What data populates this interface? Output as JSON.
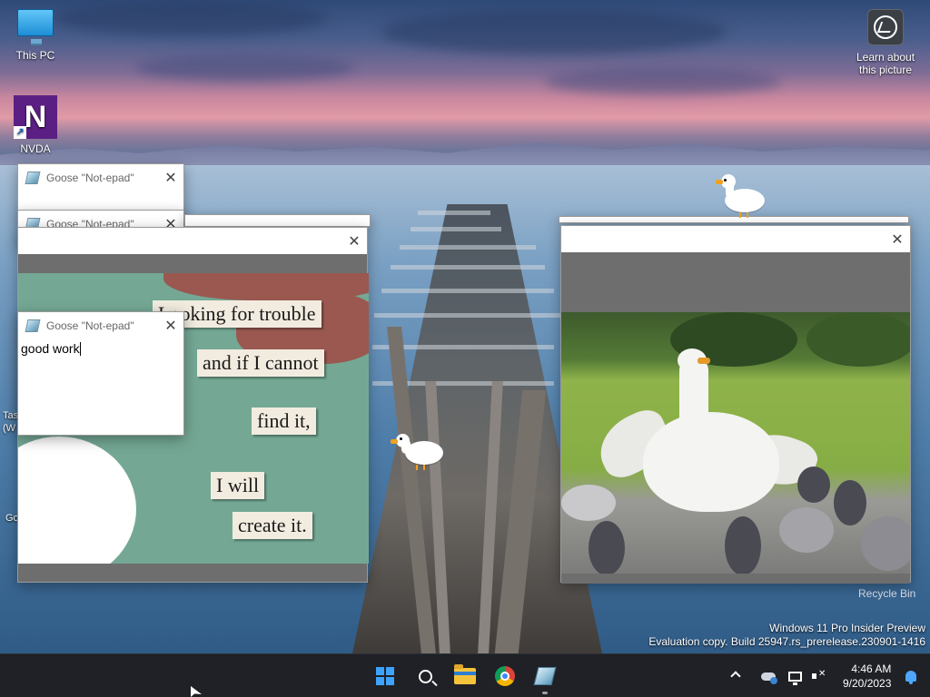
{
  "desktop": {
    "icons": {
      "this_pc": {
        "label": "This PC",
        "icon": "computer-icon"
      },
      "nvda": {
        "label": "NVDA",
        "icon": "nvda-icon"
      },
      "learn": {
        "label": "Learn about this picture",
        "icon": "camera-icon"
      },
      "recycle_bin": {
        "label": "Recycle Bin",
        "icon": "recycle-bin-icon"
      }
    },
    "clipped_labels": [
      "Tas",
      "(W",
      "Go"
    ],
    "watermark": {
      "line1": "Windows 11 Pro Insider Preview",
      "line2": "Evaluation copy. Build 25947.rs_prerelease.230901-1416"
    }
  },
  "windows": {
    "notepad_back1": {
      "title": "Goose \"Not-epad\"",
      "close": "✕"
    },
    "notepad_back2": {
      "title": "Goose \"Not-epad\"",
      "close": "✕"
    },
    "meme_window": {
      "close": "✕",
      "meme_lines": [
        "Looking for trouble",
        "and if I cannot",
        "find it,",
        "I will",
        "create it."
      ]
    },
    "notepad_front": {
      "title": "Goose \"Not-epad\"",
      "close": "✕",
      "text": "good work"
    },
    "photo_window": {
      "close": "✕"
    }
  },
  "taskbar": {
    "apps": [
      {
        "name": "start",
        "icon": "windows-icon"
      },
      {
        "name": "search",
        "icon": "search-icon"
      },
      {
        "name": "file-explorer",
        "icon": "folder-icon"
      },
      {
        "name": "chrome",
        "icon": "chrome-icon"
      },
      {
        "name": "notepad",
        "icon": "notepad-icon"
      }
    ],
    "tray": {
      "time": "4:46 AM",
      "date": "9/20/2023"
    }
  },
  "colors": {
    "taskbar": "#1f2126",
    "start_blue": "#3ea3ff",
    "meme_green": "#74a894",
    "meme_red": "#9a5850"
  }
}
